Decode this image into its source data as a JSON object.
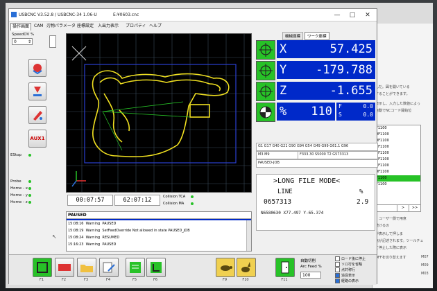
{
  "window": {
    "title": "USBCNC V3.52.8 / USBCNC-34 1.06-U",
    "file": "E:¥0603.cnc"
  },
  "menu": {
    "tabs": [
      "操作画面",
      "CAM",
      "刃物パラメータ",
      "座標設定",
      "入出力表示",
      "プロパティ",
      "ヘルプ"
    ]
  },
  "left": {
    "speed_label": "SpeedOV %",
    "speed_value": "0",
    "estop_label": "EStop",
    "aux_label": "AUX1",
    "probe_items": [
      "Probe",
      "Home - x",
      "Home - y",
      "Home - z"
    ]
  },
  "times": {
    "elapsed": "00:07:57",
    "remaining": "62:07:12"
  },
  "collisions": [
    "Collision TCA",
    "Collision MA"
  ],
  "coords": {
    "tabs": [
      "機械座標",
      "ワーク座標"
    ],
    "x": {
      "label": "X",
      "value": "57.425"
    },
    "y": {
      "label": "Y",
      "value": "-179.788"
    },
    "z": {
      "label": "Z",
      "value": "-1.655"
    },
    "feed": {
      "label": "%",
      "value": "110"
    },
    "feed_f_label": "F",
    "feed_s_label": "S",
    "feed_f_value": "0.0",
    "feed_s_value": "0.0"
  },
  "gcodes": {
    "modal": "G1 G17 G40 G21 G90 G94 G54 G49 G99 G61.1 G96",
    "m_codes": "M3 M9",
    "f_codes": "F333.30 S5000 T2 G573313",
    "state": "PAUSED-JOB"
  },
  "longfile": {
    "title": ">LONG FILE MODE<",
    "line_label": "LINE",
    "pct_label": "%",
    "line_value": "0657313",
    "pct_value": "2.9",
    "current": "N6580630 X77.497 Y-65.374"
  },
  "log": {
    "header": "PAUSED",
    "rows": [
      {
        "time": "15:08:16",
        "level": "Warning",
        "msg": "PAUSED"
      },
      {
        "time": "15:08:19",
        "level": "Warning",
        "msg": "SetFeedOverride Not allowed in state PAUSED_JOB"
      },
      {
        "time": "15:08:24",
        "level": "Warning",
        "msg": "RESUMED"
      },
      {
        "time": "15:16:23",
        "level": "Warning",
        "msg": "PAUSED"
      }
    ]
  },
  "bottom": {
    "fkeys": [
      "F1",
      "F2",
      "F3",
      "F4",
      "F5",
      "F6",
      "F9",
      "F10",
      "F11"
    ],
    "auto_cut": "自動切削",
    "arc_feed": "Arc Feed %",
    "arc_value": "100",
    "checks": [
      "ロード後に停止",
      "ソロ行を省略",
      "点対称行",
      "追従表示",
      "経路の表示"
    ]
  },
  "background": {
    "text_lines": [
      "んだ。図を開いている",
      "することができます。",
      "表示し、入力した数値によっ",
      "自動でNCコード開始位",
      "、ユーザー側で用意",
      "続けるの",
      "が表示して押しま",
      "点が記述されます。ツールチェ",
      "て停止した際に表示",
      "OFFを切り替えます"
    ],
    "list": [
      "F1100",
      "0F1100",
      "0F1100",
      "0F1100",
      "0F1100",
      "0F1100",
      "0F1100",
      "0F1100",
      "F1100",
      "F1100"
    ],
    "nav": [
      ">",
      ">>"
    ],
    "labels": [
      "M07",
      "M09",
      "M03"
    ]
  },
  "colors": {
    "accent_green": "#27c227",
    "axis_blue": "#0029c9",
    "toolpath": "#f0e020"
  }
}
